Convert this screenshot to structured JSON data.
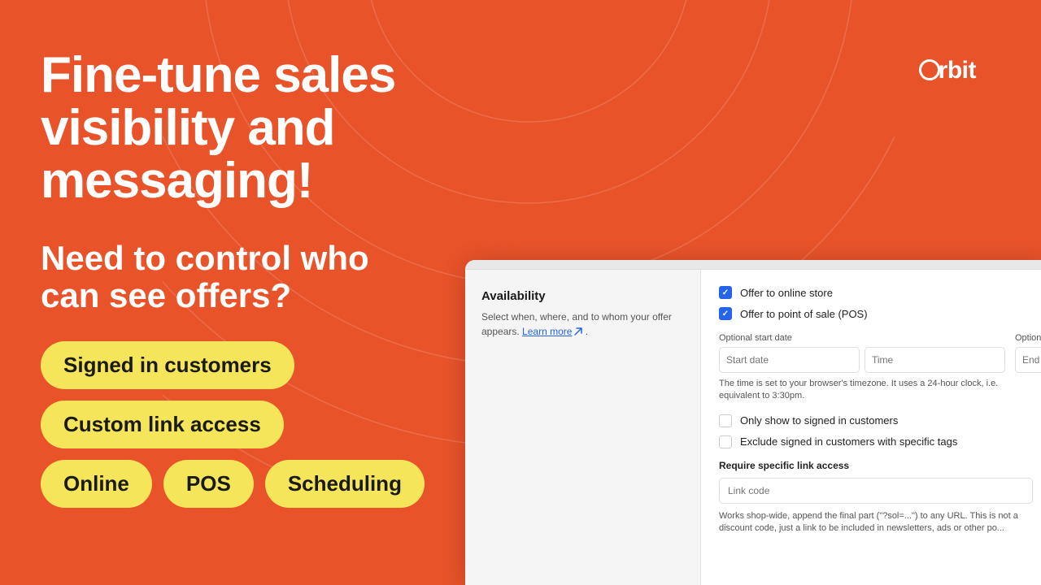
{
  "background_color": "#e8532a",
  "logo": {
    "text": "Orbit",
    "brand": "Orbit"
  },
  "headline": {
    "main": "Fine-tune sales visibility and messaging!",
    "sub": "Need to control who can see offers?"
  },
  "badges": [
    {
      "label": "Signed in customers",
      "row": 1
    },
    {
      "label": "Custom link access",
      "row": 2
    },
    {
      "label": "Online",
      "row": 3
    },
    {
      "label": "POS",
      "row": 3
    },
    {
      "label": "Scheduling",
      "row": 3
    }
  ],
  "panel": {
    "section_title": "Availability",
    "section_desc": "Select when, where, and to whom your offer appears.",
    "learn_more_label": "Learn more",
    "checkboxes": [
      {
        "label": "Offer to online store",
        "checked": true
      },
      {
        "label": "Offer to point of sale (POS)",
        "checked": true
      }
    ],
    "optional_start_date_label": "Optional start date",
    "optional_end_date_label": "Optional end date",
    "start_date_placeholder": "Start date",
    "time_placeholder": "Time",
    "end_date_placeholder": "End date",
    "timezone_note": "The time is set to your browser's timezone. It uses a 24-hour clock, i.e. equivalent to 3:30pm.",
    "customer_checkboxes": [
      {
        "label": "Only show to signed in customers",
        "checked": false
      },
      {
        "label": "Exclude signed in customers with specific tags",
        "checked": false
      }
    ],
    "link_section_label": "Require specific link access",
    "link_placeholder": "Link code",
    "link_desc": "Works shop-wide, append the final part (\"?sol=...\") to any URL. This is not a discount code, just a link to be included in newsletters, ads or other po..."
  }
}
